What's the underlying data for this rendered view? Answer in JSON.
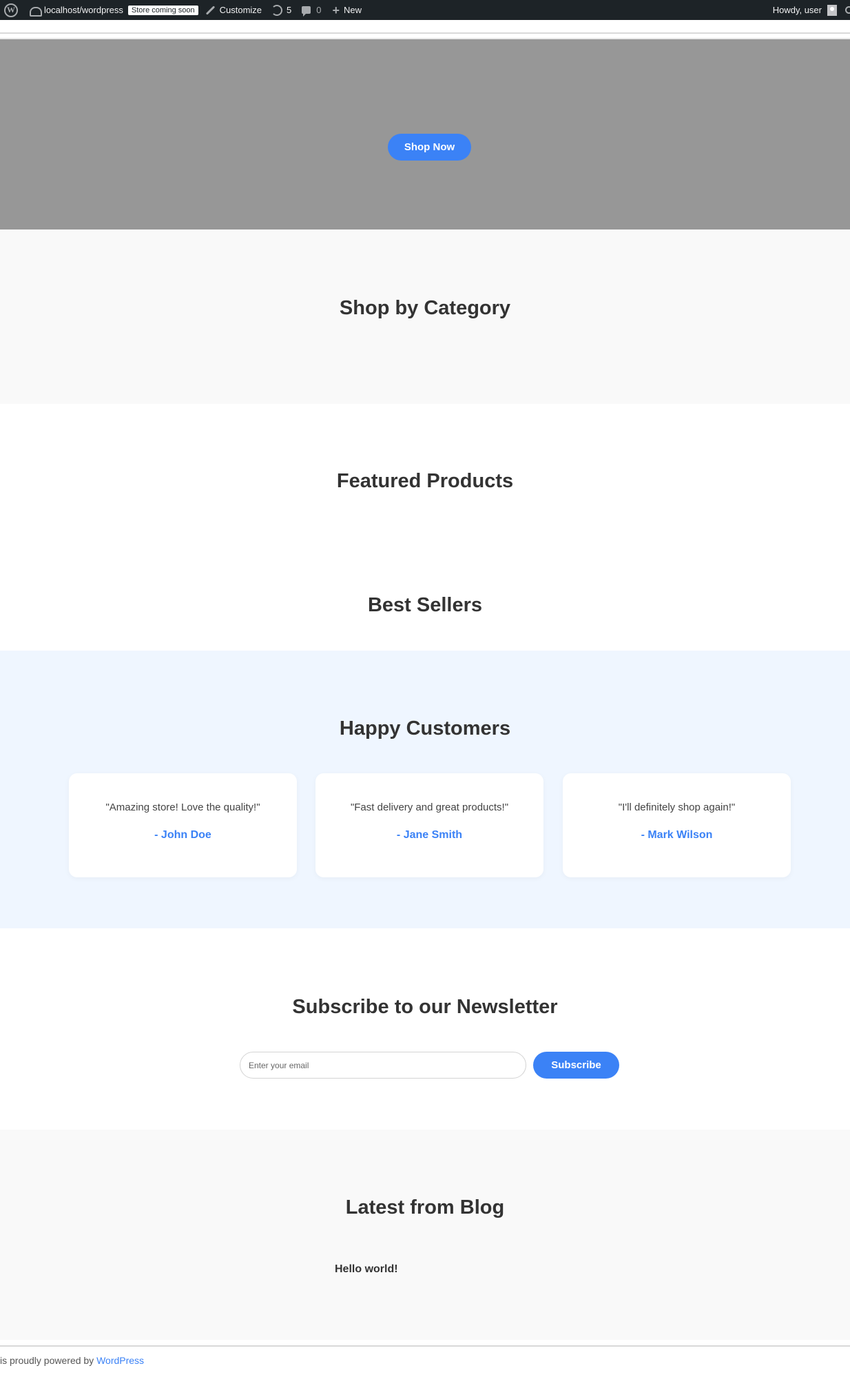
{
  "admin_bar": {
    "site_name": "localhost/wordpress",
    "store_badge": "Store coming soon",
    "customize_label": "Customize",
    "updates_count": "5",
    "comments_count": "0",
    "new_label": "New",
    "greeting": "Howdy, user",
    "icons": {
      "logo": "wordpress-logo-icon",
      "site": "dashboard-icon",
      "customize": "brush-icon",
      "updates": "update-icon",
      "comments": "comment-icon",
      "new": "plus-icon",
      "search": "search-icon"
    }
  },
  "hero": {
    "button_label": "Shop Now"
  },
  "sections": {
    "category_title": "Shop by Category",
    "featured_title": "Featured Products",
    "bestsellers_title": "Best Sellers",
    "testimonials_title": "Happy Customers",
    "newsletter_title": "Subscribe to our Newsletter",
    "blog_title": "Latest from Blog"
  },
  "testimonials": [
    {
      "quote": "\"Amazing store! Love the quality!\"",
      "author": "- John Doe"
    },
    {
      "quote": "\"Fast delivery and great products!\"",
      "author": "- Jane Smith"
    },
    {
      "quote": "\"I'll definitely shop again!\"",
      "author": "- Mark Wilson"
    }
  ],
  "newsletter": {
    "placeholder": "Enter your email",
    "button_label": "Subscribe"
  },
  "blog": {
    "posts": [
      "Hello world!"
    ]
  },
  "footer": {
    "text": "is proudly powered by ",
    "link_label": "WordPress"
  },
  "colors": {
    "accent": "#3b82f6",
    "admin_bar_bg": "#1d2327",
    "hero_bg": "#979797",
    "testimonials_bg": "#eff6ff",
    "section_alt_bg": "#f9f9f9"
  }
}
